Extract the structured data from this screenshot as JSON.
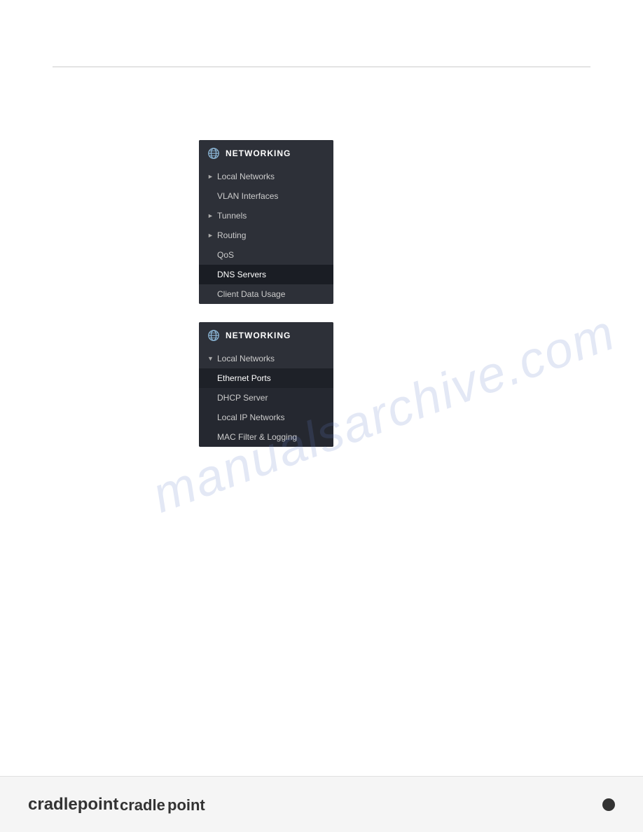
{
  "page": {
    "background": "#ffffff"
  },
  "watermark": {
    "text": "manualsarchive.com"
  },
  "menu1": {
    "header": {
      "icon": "globe-icon",
      "title": "NETWORKING"
    },
    "items": [
      {
        "id": "local-networks",
        "label": "Local Networks",
        "hasArrow": true,
        "arrowDir": "right",
        "active": false
      },
      {
        "id": "vlan-interfaces",
        "label": "VLAN Interfaces",
        "hasArrow": false,
        "active": false
      },
      {
        "id": "tunnels",
        "label": "Tunnels",
        "hasArrow": true,
        "arrowDir": "right",
        "active": false
      },
      {
        "id": "routing",
        "label": "Routing",
        "hasArrow": true,
        "arrowDir": "right",
        "active": false
      },
      {
        "id": "qos",
        "label": "QoS",
        "hasArrow": false,
        "active": false
      },
      {
        "id": "dns-servers",
        "label": "DNS Servers",
        "hasArrow": false,
        "active": true
      },
      {
        "id": "client-data-usage",
        "label": "Client Data Usage",
        "hasArrow": false,
        "active": false
      }
    ]
  },
  "menu2": {
    "header": {
      "icon": "globe-icon",
      "title": "NETWORKING"
    },
    "items": [
      {
        "id": "local-networks-expanded",
        "label": "Local Networks",
        "hasArrow": true,
        "arrowDir": "down",
        "active": false
      }
    ],
    "subitems": [
      {
        "id": "ethernet-ports",
        "label": "Ethernet Ports",
        "active": true
      },
      {
        "id": "dhcp-server",
        "label": "DHCP Server",
        "active": false
      },
      {
        "id": "local-ip-networks",
        "label": "Local IP Networks",
        "active": false
      },
      {
        "id": "mac-filter-logging",
        "label": "MAC Filter & Logging",
        "active": false
      }
    ]
  },
  "footer": {
    "logo": {
      "text_main": "cradle",
      "text_accent": "point"
    },
    "dot_label": "footer-dot"
  }
}
